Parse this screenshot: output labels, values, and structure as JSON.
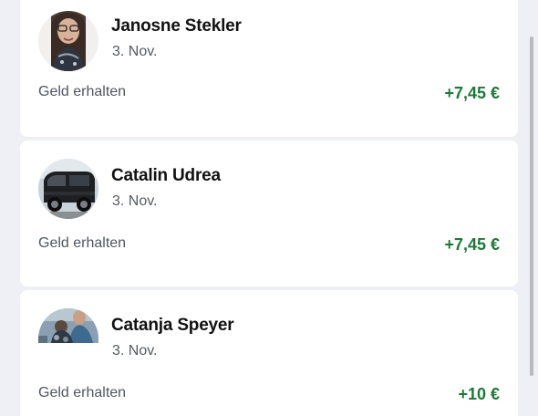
{
  "transactions": [
    {
      "name": "Janosne Stekler",
      "date": "3. Nov.",
      "type_label": "Geld erhalten",
      "amount": "+7,45 €",
      "avatar_icon": "person-photo-avatar"
    },
    {
      "name": "Catalin Udrea",
      "date": "3. Nov.",
      "type_label": "Geld erhalten",
      "amount": "+7,45 €",
      "avatar_icon": "van-photo-avatar"
    },
    {
      "name": "Catanja Speyer",
      "date": "3. Nov.",
      "type_label": "Geld erhalten",
      "amount": "+10 €",
      "avatar_icon": "group-photo-avatar"
    }
  ],
  "colors": {
    "background": "#eef0f5",
    "card": "#ffffff",
    "amount_positive": "#1c7a34",
    "secondary_text": "#555a63"
  }
}
